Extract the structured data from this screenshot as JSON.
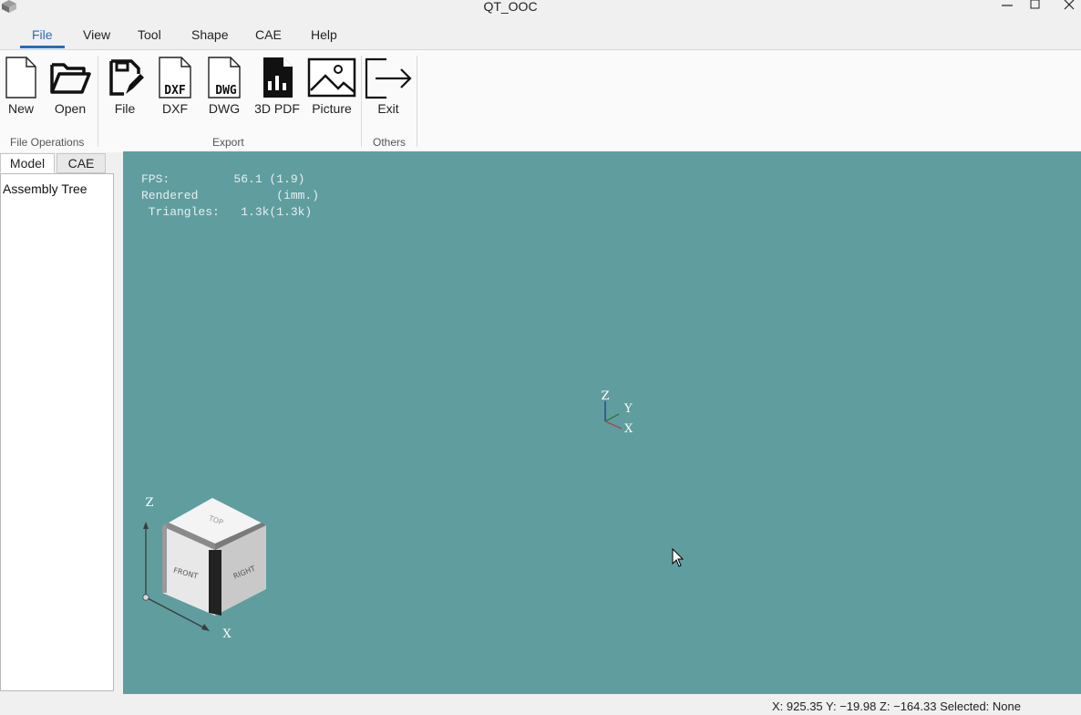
{
  "window": {
    "title": "QT_OOC"
  },
  "menu": {
    "items": [
      "File",
      "View",
      "Tool",
      "Shape",
      "CAE",
      "Help"
    ]
  },
  "ribbon": {
    "file_ops": {
      "group_label": "File Operations",
      "new_label": "New",
      "open_label": "Open"
    },
    "export": {
      "group_label": "Export",
      "file_label": "File",
      "dxf_label": "DXF",
      "dwg_label": "DWG",
      "pdf3d_label": "3D PDF",
      "picture_label": "Picture",
      "dxf_glyph": "DXF",
      "dwg_glyph": "DWG"
    },
    "others": {
      "group_label": "Others",
      "exit_label": "Exit"
    }
  },
  "left_panel": {
    "tabs": [
      "Model",
      "CAE"
    ],
    "tree_root": "Assembly Tree"
  },
  "viewport": {
    "background": "#609d9f",
    "stats": {
      "line1": "FPS:         56.1 (1.9)",
      "line2": "Rendered           (imm.)",
      "line3": " Triangles:   1.3k(1.3k)"
    },
    "trihedron": {
      "z": "Z",
      "y": "Y",
      "x": "X"
    },
    "view_cube": {
      "top": "TOP",
      "front": "FRONT",
      "right": "RIGHT",
      "axis_z": "Z",
      "axis_x": "X"
    }
  },
  "status": {
    "coords": "X: 925.35 Y: −19.98 Z: −164.33",
    "selected": "Selected: None"
  },
  "icons": [
    "app-icon",
    "minimize-icon",
    "maximize-icon",
    "close-icon",
    "new-file-icon",
    "open-folder-icon",
    "export-file-icon",
    "dxf-icon",
    "dwg-icon",
    "pdf-chart-icon",
    "picture-icon",
    "exit-icon",
    "cursor-icon"
  ],
  "colors": {
    "accent": "#2a6bbd",
    "viewport": "#609d9f"
  }
}
